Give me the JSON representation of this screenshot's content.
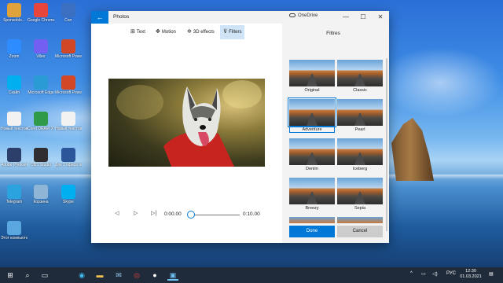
{
  "desktop": {
    "icons": [
      {
        "label": "Sponsoblo...",
        "icon": "folder-icon",
        "color": "#e0a23a"
      },
      {
        "label": "Google Chrome",
        "icon": "chrome-icon",
        "color": "#e8453c"
      },
      {
        "label": "Corr",
        "icon": "app-icon",
        "color": "#3b6fc2"
      },
      {
        "label": "Zoom",
        "icon": "zoom-icon",
        "color": "#2d8cff"
      },
      {
        "label": "Viber",
        "icon": "viber-icon",
        "color": "#7360f2"
      },
      {
        "label": "Microsoft PowerPoi...",
        "icon": "powerpoint-icon",
        "color": "#d24726"
      },
      {
        "label": "Скайп",
        "icon": "skype-icon",
        "color": "#00aff0"
      },
      {
        "label": "Microsoft Edge",
        "icon": "edge-icon",
        "color": "#2b9bd6"
      },
      {
        "label": "Microsoft PowerPoint...",
        "icon": "powerpoint-icon",
        "color": "#d24726"
      },
      {
        "label": "Новый текстовый...",
        "icon": "text-file-icon",
        "color": "#f2f2f2"
      },
      {
        "label": "Corel DRAW X7",
        "icon": "coreldraw-icon",
        "color": "#2f9a48"
      },
      {
        "label": "Новый текстовый...",
        "icon": "text-file-icon",
        "color": "#f2f2f2"
      },
      {
        "label": "Adobe Photosh...",
        "icon": "photoshop-icon",
        "color": "#2c3f6b"
      },
      {
        "label": "OBS Studio",
        "icon": "obs-icon",
        "color": "#302e31"
      },
      {
        "label": "Док 1 офисе.docx",
        "icon": "word-icon",
        "color": "#2b579a"
      },
      {
        "label": "Telegram",
        "icon": "telegram-icon",
        "color": "#2aa3df"
      },
      {
        "label": "Корзина",
        "icon": "recycle-bin-icon",
        "color": "#8fb5d6"
      },
      {
        "label": "Skype",
        "icon": "skype-icon",
        "color": "#00aff0"
      },
      {
        "label": "Этот компьютер",
        "icon": "computer-icon",
        "color": "#5aa7e0"
      }
    ]
  },
  "window": {
    "app_title": "Photos",
    "onedrive_label": "OneDrive",
    "back_glyph": "←",
    "minimize_glyph": "—",
    "maximize_glyph": "☐",
    "close_glyph": "✕"
  },
  "toolbar": {
    "text_label": "Text",
    "motion_label": "Motion",
    "effects_label": "3D effects",
    "filters_label": "Filters"
  },
  "player": {
    "current_time": "0:00.00",
    "end_time": "0:10.00",
    "progress": 0.0
  },
  "filters_panel": {
    "title": "Filtres",
    "items": [
      {
        "name": "Original"
      },
      {
        "name": "Classic"
      },
      {
        "name": "Adventure",
        "selected": true
      },
      {
        "name": "Pearl"
      },
      {
        "name": "Denim"
      },
      {
        "name": "Iceberg"
      },
      {
        "name": "Breezy"
      },
      {
        "name": "Sepia"
      }
    ],
    "done_label": "Done",
    "cancel_label": "Cancel"
  },
  "taskbar": {
    "language": "РУС",
    "time": "12:30",
    "date": "01.03.2021"
  },
  "colors": {
    "accent": "#0078d7",
    "taskbar": "#1f2a3a"
  }
}
